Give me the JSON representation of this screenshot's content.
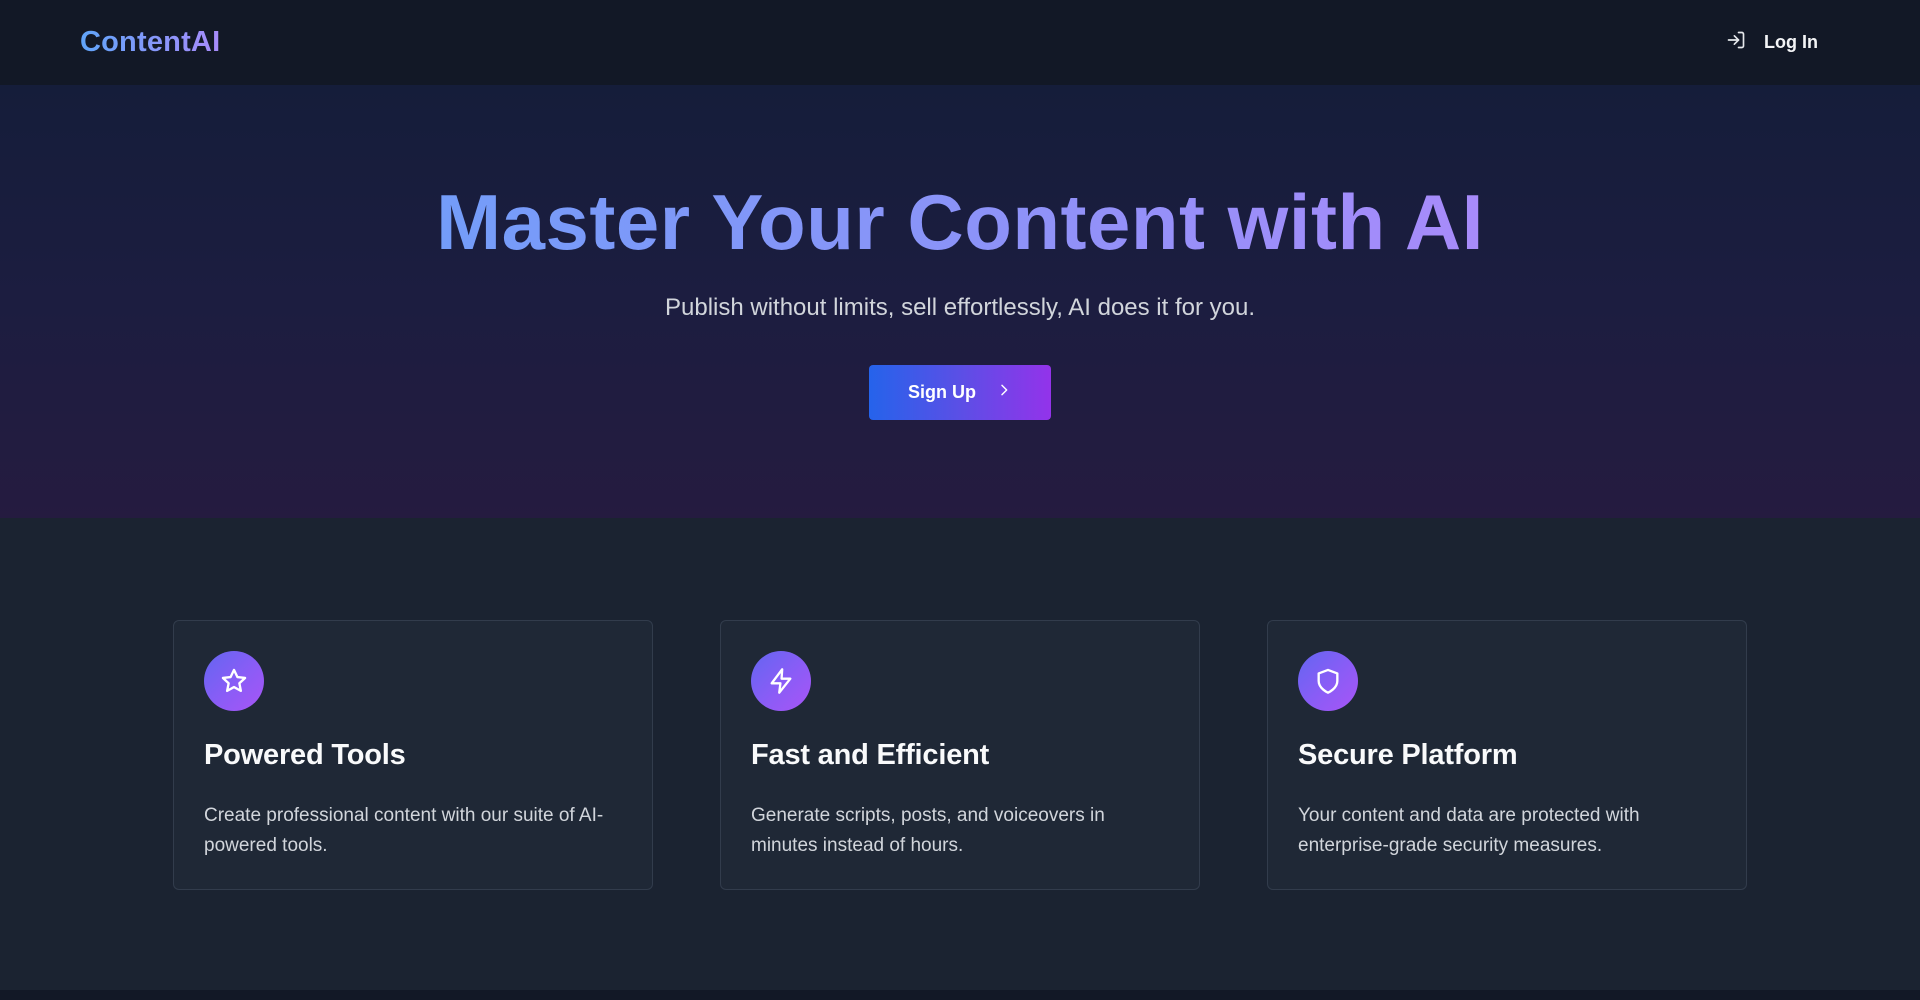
{
  "nav": {
    "brand": "ContentAI",
    "login_label": "Log In",
    "login_icon": "log-in-icon"
  },
  "hero": {
    "title": "Master Your Content with AI",
    "subtitle": "Publish without limits, sell effortlessly, AI does it for you.",
    "cta_label": "Sign Up",
    "cta_icon": "chevron-right-icon"
  },
  "features": [
    {
      "icon": "star-icon",
      "title": "Powered Tools",
      "description": "Create professional content with our suite of AI-powered tools."
    },
    {
      "icon": "zap-icon",
      "title": "Fast and Efficient",
      "description": "Generate scripts, posts, and voiceovers in minutes instead of hours."
    },
    {
      "icon": "shield-icon",
      "title": "Secure Platform",
      "description": "Your content and data are protected with enterprise-grade security measures."
    }
  ],
  "colors": {
    "nav_bg": "#121826",
    "page_bg": "#1b2331",
    "card_bg": "#1f2836",
    "accent_blue": "#60a5fa",
    "accent_purple": "#c084fc",
    "button_start": "#2563eb",
    "button_end": "#9333ea"
  }
}
